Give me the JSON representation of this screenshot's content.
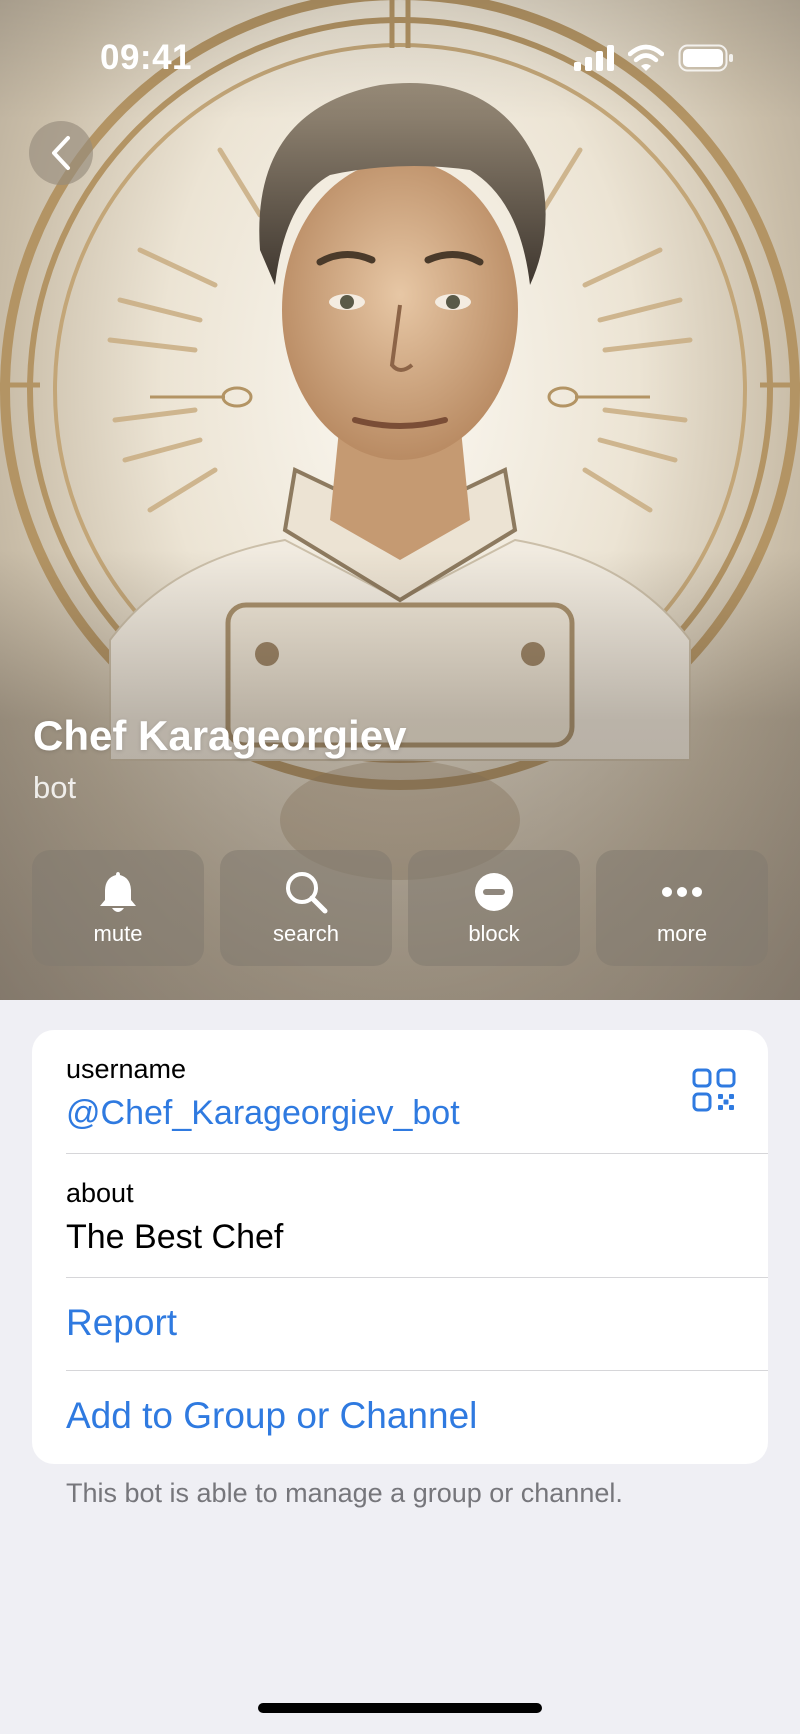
{
  "status_bar": {
    "time": "09:41"
  },
  "profile": {
    "name": "Chef Karageorgiev",
    "subtitle": "bot"
  },
  "actions": [
    {
      "label": "mute",
      "icon": "bell-icon"
    },
    {
      "label": "search",
      "icon": "search-icon"
    },
    {
      "label": "block",
      "icon": "block-icon"
    },
    {
      "label": "more",
      "icon": "more-icon"
    }
  ],
  "info": {
    "username_caption": "username",
    "username_value": "@Chef_Karageorgiev_bot",
    "about_caption": "about",
    "about_value": "The Best Chef",
    "report_label": "Report",
    "add_label": "Add to Group or Channel",
    "footnote": "This bot is able to manage a group or channel."
  },
  "colors": {
    "accent": "#2f7ae0",
    "background": "#efeff4",
    "gold": "#a8875a"
  }
}
